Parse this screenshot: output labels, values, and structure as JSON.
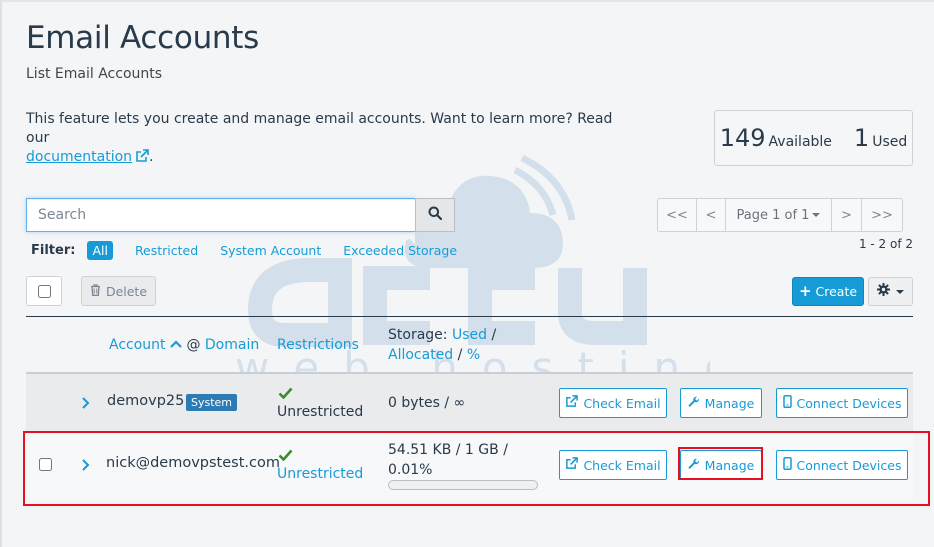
{
  "page": {
    "title": "Email Accounts",
    "subtitle": "List Email Accounts",
    "intro_text": "This feature lets you create and manage email accounts. Want to learn more? Read our",
    "intro_link": "documentation",
    "intro_end": "."
  },
  "stats": {
    "available_count": "149",
    "available_label": "Available",
    "used_count": "1",
    "used_label": "Used"
  },
  "search": {
    "placeholder": "Search"
  },
  "pagination": {
    "first": "<<",
    "prev": "<",
    "page_label": "Page 1 of 1",
    "next": ">",
    "last": ">>",
    "range": "1 - 2 of 2"
  },
  "filter": {
    "label": "Filter:",
    "options": [
      "All",
      "Restricted",
      "System Account",
      "Exceeded Storage"
    ],
    "active": "All"
  },
  "toolbar": {
    "delete_label": "Delete",
    "create_label": "Create"
  },
  "table": {
    "headers": {
      "account": "Account",
      "at": "@",
      "domain": "Domain",
      "restrictions": "Restrictions",
      "storage_prefix": "Storage:",
      "used": "Used",
      "slash1": "/",
      "allocated": "Allocated",
      "slash2": "/",
      "percent": "%"
    },
    "rows": [
      {
        "account": "demovp25",
        "badge": "System",
        "restriction": "Unrestricted",
        "storage": "0 bytes / ∞",
        "actions": [
          "Check Email",
          "Manage",
          "Connect Devices"
        ]
      },
      {
        "account": "nick@demovpstest.com",
        "restriction": "Unrestricted",
        "storage_line1": "54.51 KB / 1 GB /",
        "storage_line2": "0.01%",
        "usage_fraction": 0.0001,
        "actions": [
          "Check Email",
          "Manage",
          "Connect Devices"
        ]
      }
    ]
  },
  "watermark": {
    "brand": "accu",
    "tagline": "web hosting"
  },
  "colors": {
    "accent": "#179bd7",
    "success": "#3c8a2e",
    "highlight": "#e8101e",
    "badge": "#2d7bb5"
  }
}
